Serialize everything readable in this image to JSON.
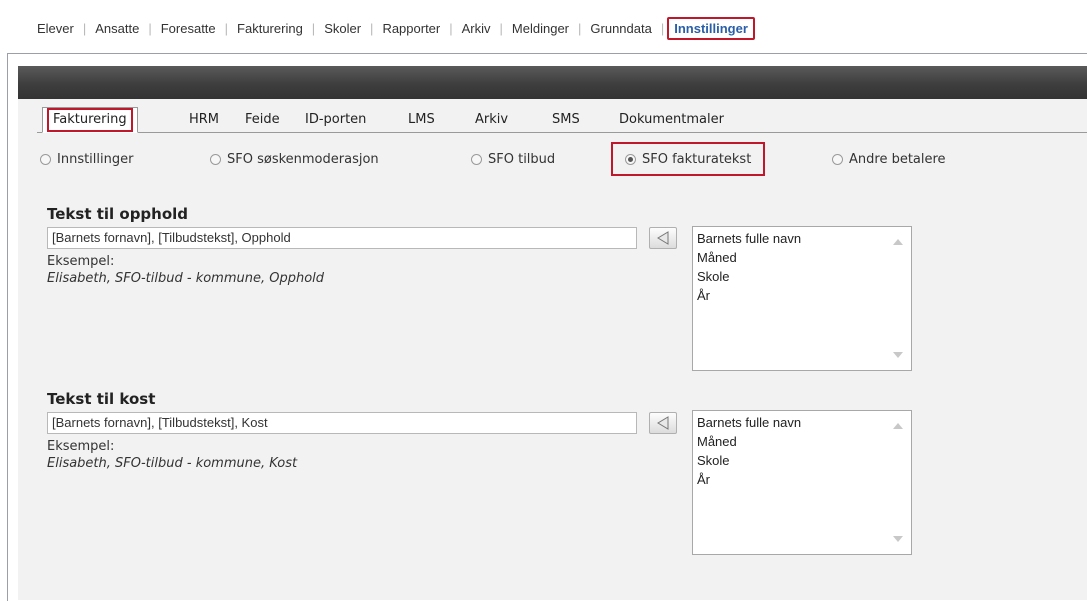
{
  "nav": {
    "items": [
      "Elever",
      "Ansatte",
      "Foresatte",
      "Fakturering",
      "Skoler",
      "Rapporter",
      "Arkiv",
      "Meldinger",
      "Grunndata",
      "Innstillinger"
    ],
    "active_index": 9
  },
  "subtabs": {
    "items": [
      "Fakturering",
      "HRM",
      "Feide",
      "ID-porten",
      "LMS",
      "Arkiv",
      "SMS",
      "Dokumentmaler"
    ],
    "active_index": 0
  },
  "radios": {
    "items": [
      "Innstillinger",
      "SFO søskenmoderasjon",
      "SFO tilbud",
      "SFO fakturatekst",
      "Andre betalere"
    ],
    "checked_index": 3
  },
  "opphold": {
    "title": "Tekst til opphold",
    "value": "[Barnets fornavn], [Tilbudstekst], Opphold",
    "example_label": "Eksempel:",
    "example_text": "Elisabeth, SFO-tilbud - kommune, Opphold",
    "options": [
      "Barnets fulle navn",
      "Måned",
      "Skole",
      "År"
    ]
  },
  "kost": {
    "title": "Tekst til kost",
    "value": "[Barnets fornavn], [Tilbudstekst], Kost",
    "example_label": "Eksempel:",
    "example_text": "Elisabeth, SFO-tilbud - kommune, Kost",
    "options": [
      "Barnets fulle navn",
      "Måned",
      "Skole",
      "År"
    ]
  },
  "icons": {
    "insert": "arrow-left-icon",
    "scroll_up": "scroll-up-icon",
    "scroll_down": "scroll-down-icon",
    "radio": "radio-button-icon"
  },
  "colors": {
    "highlight": "#c0172b",
    "active_nav": "#2a5ea8",
    "header_bar": "#3e3e3e",
    "panel": "#f2f2f2"
  }
}
